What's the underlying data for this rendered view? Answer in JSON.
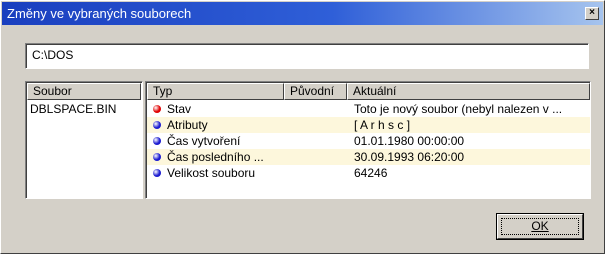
{
  "window": {
    "title": "Změny ve vybraných souborech",
    "close_glyph": "×"
  },
  "path": {
    "value": "C:\\DOS"
  },
  "files": {
    "header": "Soubor",
    "items": [
      "DBLSPACE.BIN"
    ]
  },
  "properties": {
    "headers": {
      "type": "Typ",
      "original": "Původní",
      "current": "Aktuální"
    },
    "rows": [
      {
        "name": "Stav",
        "current": "Toto je nový soubor (nebyl nalezen v ...",
        "dot_color": "#e00000"
      },
      {
        "name": "Atributy",
        "current": "[ A r h s c ]",
        "dot_color": "#1a1ad0"
      },
      {
        "name": "Čas vytvoření",
        "current": "01.01.1980 00:00:00",
        "dot_color": "#1a1ad0"
      },
      {
        "name": "Čas posledního ...",
        "current": "30.09.1993 06:20:00",
        "dot_color": "#1a1ad0"
      },
      {
        "name": "Velikost souboru",
        "current": "64246",
        "dot_color": "#1a1ad0"
      }
    ]
  },
  "buttons": {
    "ok_label": "OK"
  }
}
